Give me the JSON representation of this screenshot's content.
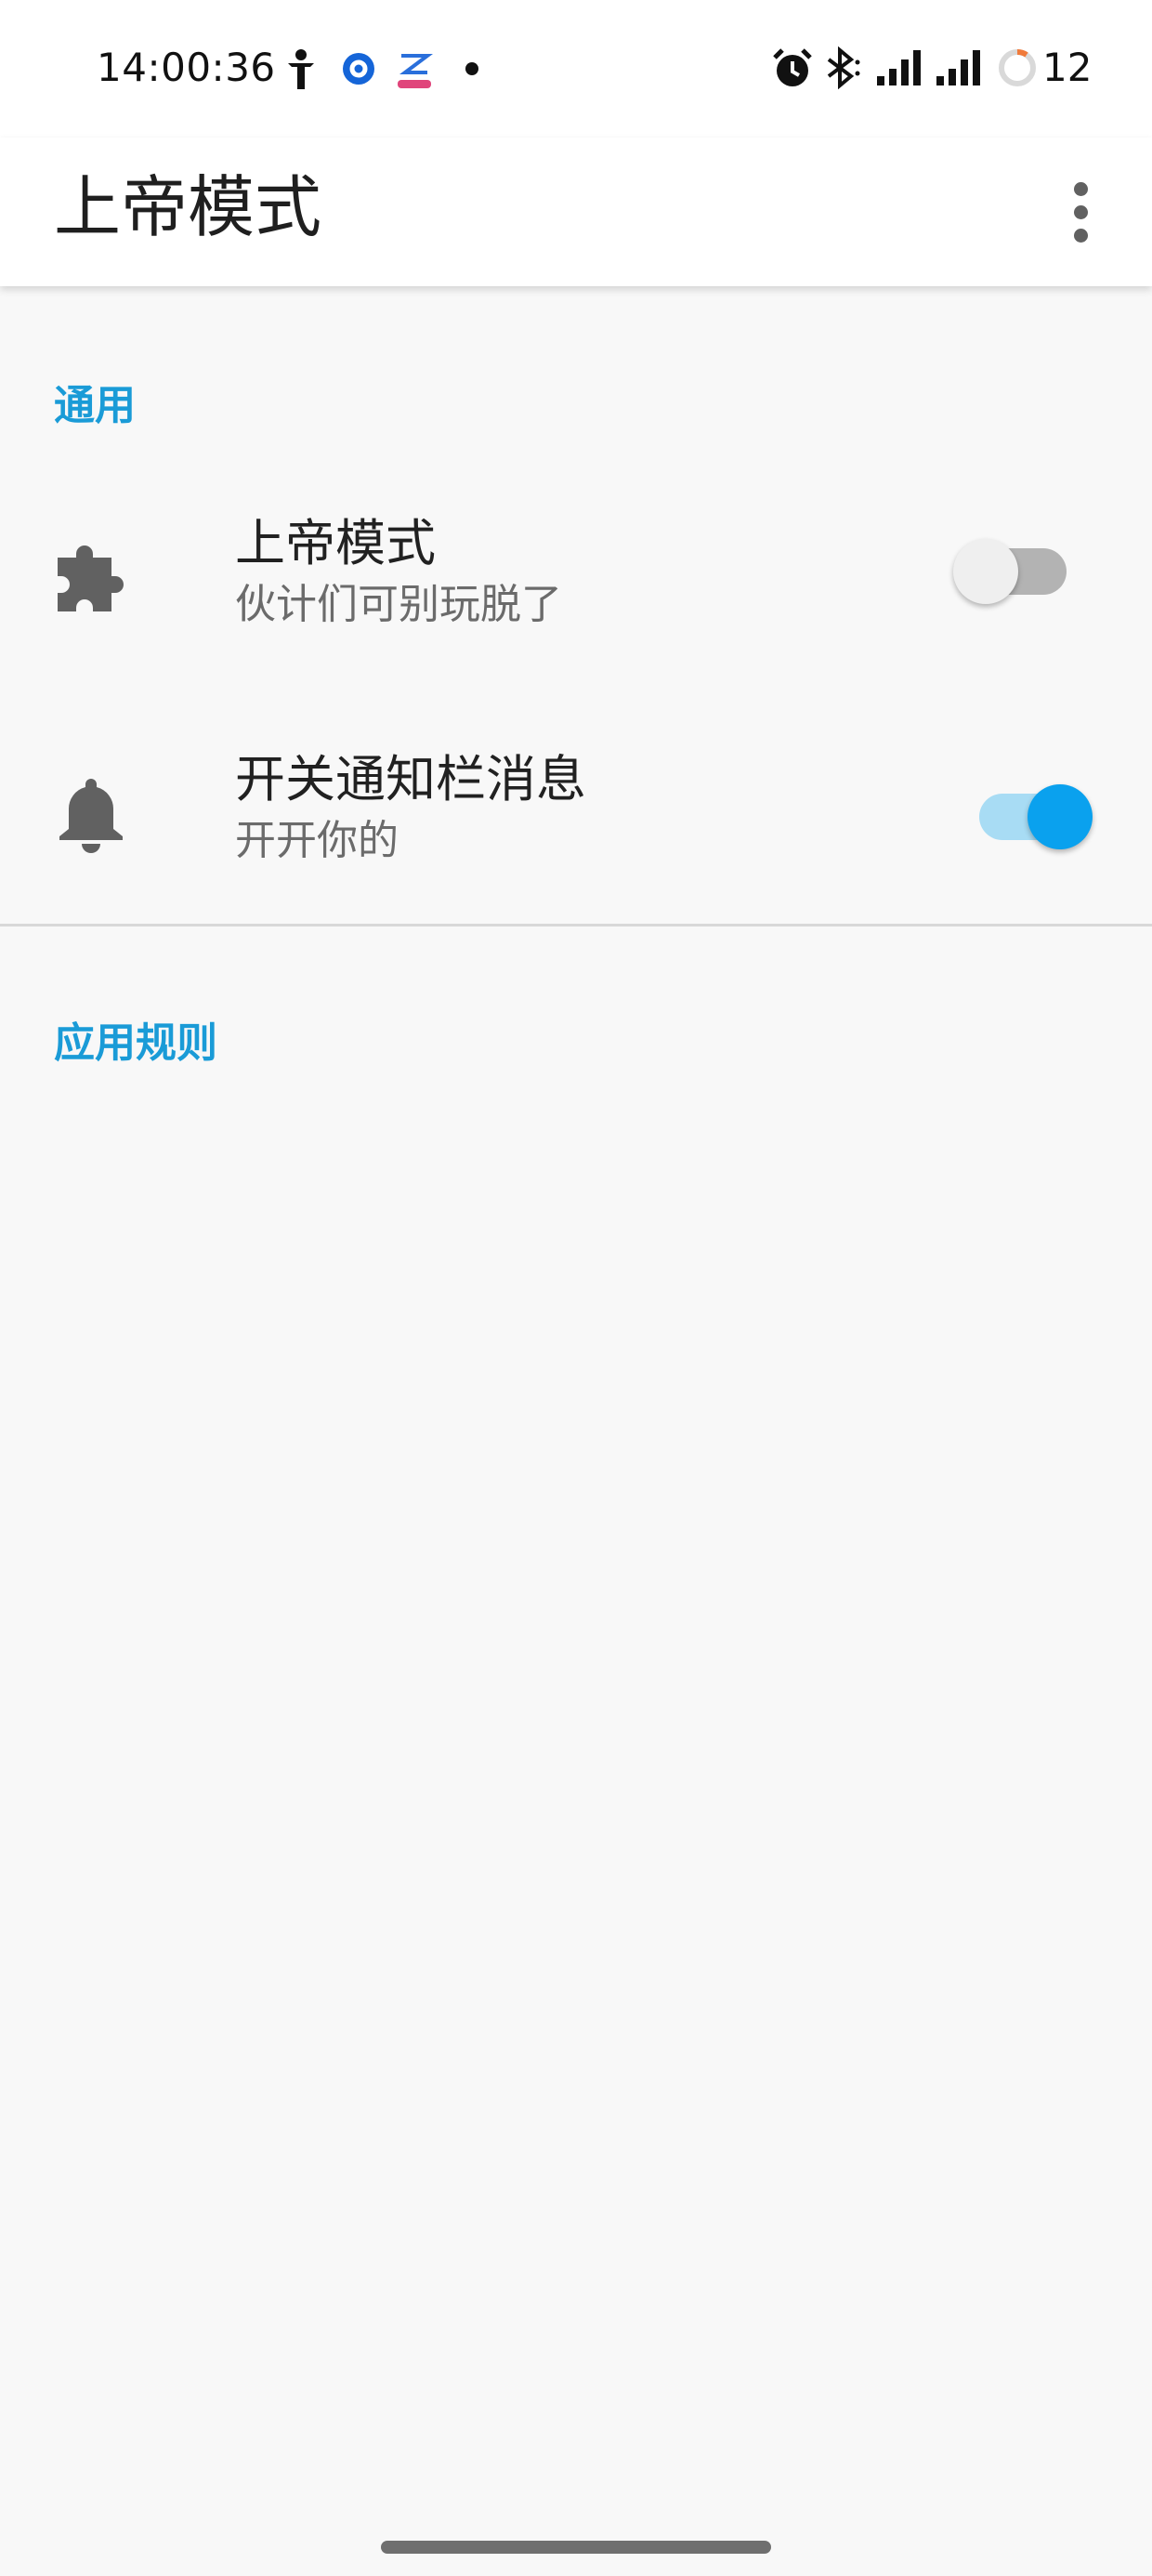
{
  "status_bar": {
    "time": "14:00:36",
    "battery_level": "12",
    "icons": [
      "figure-icon",
      "circle-app-icon",
      "app-logo-icon",
      "dot-icon",
      "alarm-icon",
      "bluetooth-icon",
      "signal-icon",
      "signal-icon",
      "battery-ring-icon"
    ]
  },
  "app_bar": {
    "title": "上帝模式",
    "overflow_icon": "more-vert-icon"
  },
  "sections": {
    "general": {
      "header": "通用",
      "items": [
        {
          "title": "上帝模式",
          "summary": "伙计们可别玩脱了",
          "icon": "puzzle-icon",
          "checked": false
        },
        {
          "title": "开关通知栏消息",
          "summary": "开开你的",
          "icon": "bell-icon",
          "checked": true
        }
      ]
    },
    "app_rules": {
      "header": "应用规则"
    }
  },
  "colors": {
    "accent": "#1a9bd7",
    "switch_on_thumb": "#0aa1ee",
    "switch_on_track": "#a8dcf4",
    "icon_gray": "#616161",
    "background": "#f8f8f8"
  }
}
